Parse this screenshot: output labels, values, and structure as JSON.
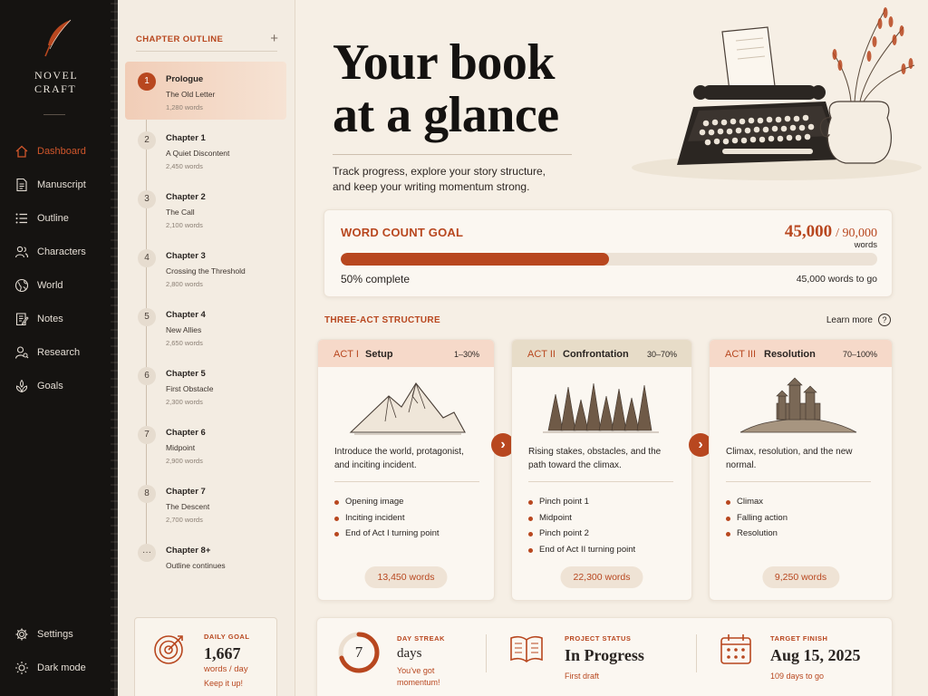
{
  "app": {
    "logo_lines": [
      "NOVEL",
      "CRAFT"
    ]
  },
  "nav": {
    "items": [
      {
        "label": "Dashboard",
        "icon": "home-icon",
        "active": true
      },
      {
        "label": "Manuscript",
        "icon": "document-icon"
      },
      {
        "label": "Outline",
        "icon": "list-icon"
      },
      {
        "label": "Characters",
        "icon": "people-icon"
      },
      {
        "label": "World",
        "icon": "globe-icon"
      },
      {
        "label": "Notes",
        "icon": "notes-icon"
      },
      {
        "label": "Research",
        "icon": "search-people-icon"
      },
      {
        "label": "Goals",
        "icon": "target-icon"
      }
    ],
    "settings_label": "Settings",
    "dark_mode_label": "Dark mode"
  },
  "outline": {
    "heading": "CHAPTER OUTLINE",
    "add_symbol": "+",
    "chapters": [
      {
        "num": "1",
        "title": "Prologue",
        "subtitle": "The Old Letter",
        "words": "1,280 words",
        "selected": true
      },
      {
        "num": "2",
        "title": "Chapter 1",
        "subtitle": "A Quiet Discontent",
        "words": "2,450 words"
      },
      {
        "num": "3",
        "title": "Chapter 2",
        "subtitle": "The Call",
        "words": "2,100 words"
      },
      {
        "num": "4",
        "title": "Chapter 3",
        "subtitle": "Crossing the Threshold",
        "words": "2,800 words"
      },
      {
        "num": "5",
        "title": "Chapter 4",
        "subtitle": "New Allies",
        "words": "2,650 words"
      },
      {
        "num": "6",
        "title": "Chapter 5",
        "subtitle": "First Obstacle",
        "words": "2,300 words"
      },
      {
        "num": "7",
        "title": "Chapter 6",
        "subtitle": "Midpoint",
        "words": "2,900 words"
      },
      {
        "num": "8",
        "title": "Chapter 7",
        "subtitle": "The Descent",
        "words": "2,700 words"
      },
      {
        "num": "···",
        "title": "Chapter 8+",
        "subtitle": "Outline continues",
        "words": ""
      }
    ],
    "daily_goal": {
      "label": "DAILY GOAL",
      "value": "1,667",
      "unit": "words / day",
      "note": "Keep it up!"
    }
  },
  "hero": {
    "title_line1": "Your book",
    "title_line2": "at a glance",
    "subtitle_line1": "Track progress, explore your story structure,",
    "subtitle_line2": "and keep your writing momentum strong."
  },
  "word_goal": {
    "label": "WORD COUNT GOAL",
    "current": "45,000",
    "total": "/ 90,000",
    "unit": "words",
    "progress": 0.5,
    "percent_label": "50% complete",
    "remaining": "45,000 words to go"
  },
  "structure": {
    "heading": "THREE-ACT STRUCTURE",
    "learn_more": "Learn more",
    "acts": [
      {
        "num": "ACT I",
        "name": "Setup",
        "range": "1–30%",
        "desc": "Introduce the world, protagonist, and inciting incident.",
        "beats": [
          "Opening image",
          "Inciting incident",
          "End of Act I turning point"
        ],
        "words": "13,450 words"
      },
      {
        "num": "ACT II",
        "name": "Confrontation",
        "range": "30–70%",
        "desc": "Rising stakes, obstacles, and the path toward the climax.",
        "beats": [
          "Pinch point 1",
          "Midpoint",
          "Pinch point 2",
          "End of Act II turning point"
        ],
        "words": "22,300 words"
      },
      {
        "num": "ACT III",
        "name": "Resolution",
        "range": "70–100%",
        "desc": "Climax, resolution, and the new normal.",
        "beats": [
          "Climax",
          "Falling action",
          "Resolution"
        ],
        "words": "9,250 words"
      }
    ]
  },
  "stats": {
    "streak": {
      "label": "DAY STREAK",
      "value": "7",
      "unit": "days",
      "note_line1": "You've got",
      "note_line2": "momentum!",
      "ring_fraction": 0.7
    },
    "status": {
      "label": "PROJECT STATUS",
      "value": "In Progress",
      "note": "First draft"
    },
    "target": {
      "label": "TARGET FINISH",
      "value": "Aug 15, 2025",
      "note": "109 days to go"
    }
  },
  "colors": {
    "accent": "#b8471f",
    "sidebar": "#151311",
    "background": "#f6efe5"
  }
}
